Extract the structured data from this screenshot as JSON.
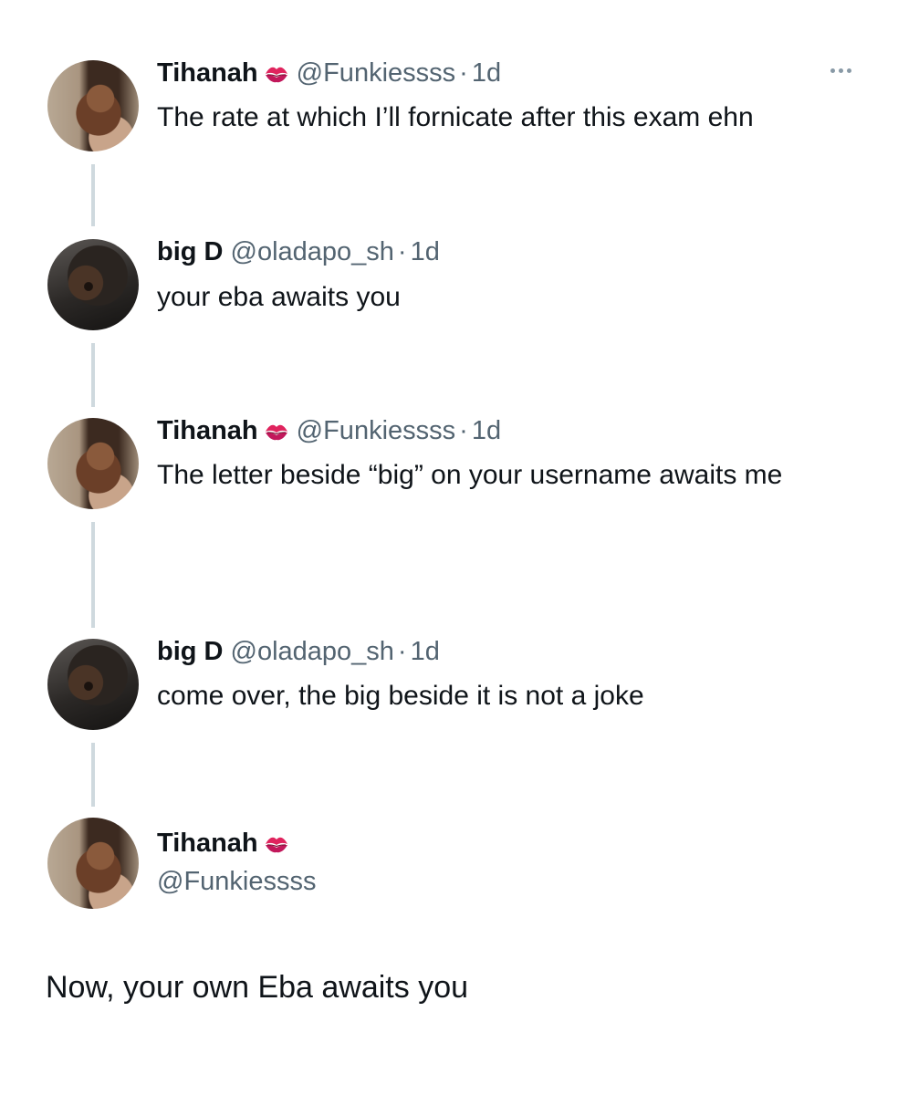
{
  "thread": {
    "tweets": [
      {
        "name": "Tihanah",
        "badge_icon": "kiss-mark-icon",
        "handle": "@Funkiessss",
        "time": "1d",
        "text": "The rate at which I’ll fornicate after this exam ehn",
        "more_icon": "more-options-icon"
      },
      {
        "name": "big D",
        "handle": "@oladapo_sh",
        "time": "1d",
        "text": "your eba awaits you"
      },
      {
        "name": "Tihanah",
        "badge_icon": "kiss-mark-icon",
        "handle": "@Funkiessss",
        "time": "1d",
        "text": "The  letter beside “big” on your username awaits me"
      },
      {
        "name": "big D",
        "handle": "@oladapo_sh",
        "time": "1d",
        "text": "come over, the big beside it is not a joke"
      }
    ],
    "main_tweet": {
      "name": "Tihanah",
      "badge_icon": "kiss-mark-icon",
      "handle": "@Funkiessss",
      "text": "Now, your own Eba awaits you"
    }
  },
  "colors": {
    "text": "#0f1419",
    "secondary": "#536471",
    "thread_line": "#cfd9de",
    "badge": "#e0245e"
  }
}
